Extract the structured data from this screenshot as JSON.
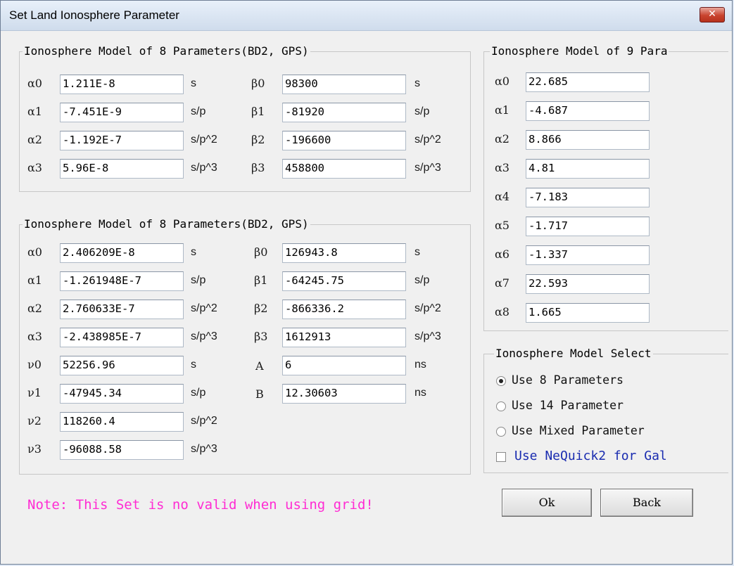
{
  "window": {
    "title": "Set Land Ionosphere Parameter",
    "close_glyph": "✕"
  },
  "group1": {
    "title": "Ionosphere Model of 8 Parameters(BD2,  GPS)",
    "rows": [
      {
        "a_label": "α0",
        "a_value": "1.211E-8",
        "a_unit": "s",
        "b_label": "β0",
        "b_value": "98300",
        "b_unit": "s"
      },
      {
        "a_label": "α1",
        "a_value": "-7.451E-9",
        "a_unit": "s/p",
        "b_label": "β1",
        "b_value": "-81920",
        "b_unit": "s/p"
      },
      {
        "a_label": "α2",
        "a_value": "-1.192E-7",
        "a_unit": "s/p^2",
        "b_label": "β2",
        "b_value": "-196600",
        "b_unit": "s/p^2"
      },
      {
        "a_label": "α3",
        "a_value": "5.96E-8",
        "a_unit": "s/p^3",
        "b_label": "β3",
        "b_value": "458800",
        "b_unit": "s/p^3"
      }
    ]
  },
  "group2": {
    "title": "Ionosphere Model of 8 Parameters(BD2,  GPS)",
    "rows": [
      {
        "a_label": "α0",
        "a_value": "2.406209E-8",
        "a_unit": "s",
        "b_label": "β0",
        "b_value": "126943.8",
        "b_unit": "s"
      },
      {
        "a_label": "α1",
        "a_value": "-1.261948E-7",
        "a_unit": "s/p",
        "b_label": "β1",
        "b_value": "-64245.75",
        "b_unit": "s/p"
      },
      {
        "a_label": "α2",
        "a_value": "2.760633E-7",
        "a_unit": "s/p^2",
        "b_label": "β2",
        "b_value": "-866336.2",
        "b_unit": "s/p^2"
      },
      {
        "a_label": "α3",
        "a_value": "-2.438985E-7",
        "a_unit": "s/p^3",
        "b_label": "β3",
        "b_value": "1612913",
        "b_unit": "s/p^3"
      }
    ],
    "nu_rows": [
      {
        "label": "ν0",
        "value": "52256.96",
        "unit": "s"
      },
      {
        "label": "ν1",
        "value": "-47945.34",
        "unit": "s/p"
      },
      {
        "label": "ν2",
        "value": "118260.4",
        "unit": "s/p^2"
      },
      {
        "label": "ν3",
        "value": "-96088.58",
        "unit": "s/p^3"
      }
    ],
    "extra_rows": [
      {
        "label": "A",
        "value": "6",
        "unit": "ns"
      },
      {
        "label": "B",
        "value": "12.30603",
        "unit": "ns"
      }
    ]
  },
  "group3": {
    "title": "Ionosphere Model of 9 Para",
    "rows": [
      {
        "label": "α0",
        "value": "22.685"
      },
      {
        "label": "α1",
        "value": "-4.687"
      },
      {
        "label": "α2",
        "value": "8.866"
      },
      {
        "label": "α3",
        "value": "4.81"
      },
      {
        "label": "α4",
        "value": "-7.183"
      },
      {
        "label": "α5",
        "value": "-1.717"
      },
      {
        "label": "α6",
        "value": "-1.337"
      },
      {
        "label": "α7",
        "value": "22.593"
      },
      {
        "label": "α8",
        "value": "1.665"
      }
    ]
  },
  "select": {
    "title": "Ionosphere Model  Select",
    "options": [
      {
        "label": "Use 8 Parameters",
        "checked": true
      },
      {
        "label": "Use 14 Parameter",
        "checked": false
      },
      {
        "label": "Use Mixed Parameter",
        "checked": false
      }
    ],
    "checkbox_label": "Use NeQuick2 for Gal",
    "checkbox_checked": false
  },
  "note": "Note: This Set is no valid when using grid!",
  "buttons": {
    "ok": "Ok",
    "back": "Back"
  },
  "colors": {
    "note": "#ff2bd3",
    "checkbox_label": "#1a2cb0",
    "close": "#c9442f"
  }
}
